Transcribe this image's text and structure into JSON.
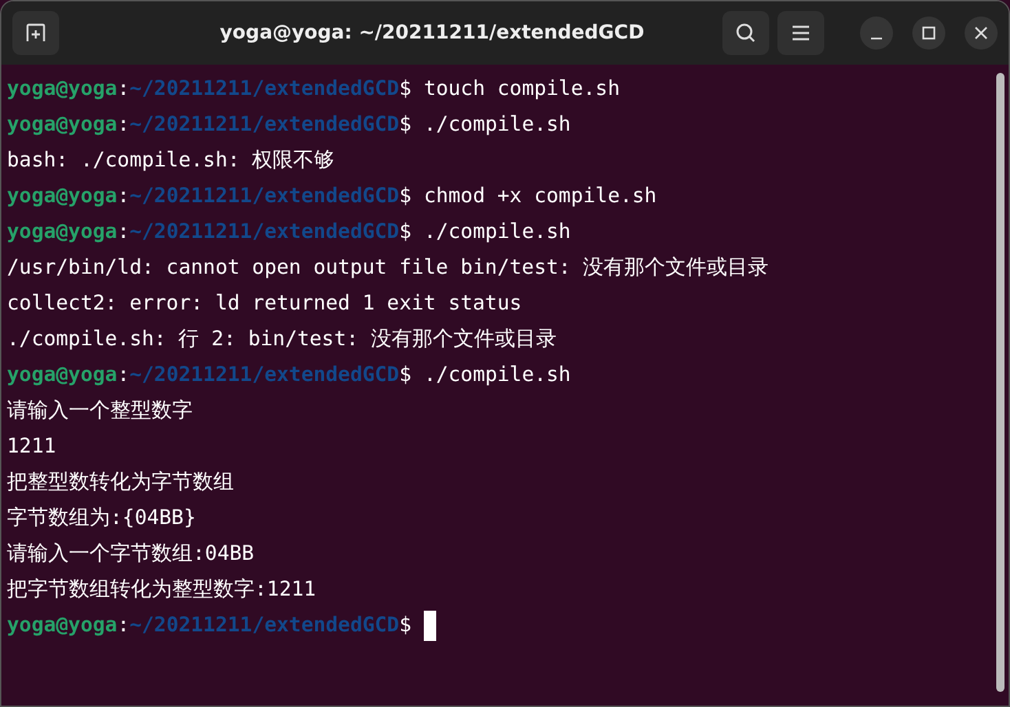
{
  "window": {
    "title": "yoga@yoga: ~/20211211/extendedGCD"
  },
  "lines": [
    {
      "kind": "prompt",
      "user": "yoga@yoga",
      "colon": ":",
      "path": "~/20211211/extendedGCD",
      "dollar": "$",
      "command": " touch compile.sh"
    },
    {
      "kind": "prompt",
      "user": "yoga@yoga",
      "colon": ":",
      "path": "~/20211211/extendedGCD",
      "dollar": "$",
      "command": " ./compile.sh"
    },
    {
      "kind": "output",
      "text": "bash: ./compile.sh: 权限不够"
    },
    {
      "kind": "prompt",
      "user": "yoga@yoga",
      "colon": ":",
      "path": "~/20211211/extendedGCD",
      "dollar": "$",
      "command": " chmod +x compile.sh"
    },
    {
      "kind": "prompt",
      "user": "yoga@yoga",
      "colon": ":",
      "path": "~/20211211/extendedGCD",
      "dollar": "$",
      "command": " ./compile.sh"
    },
    {
      "kind": "output",
      "text": "/usr/bin/ld: cannot open output file bin/test: 没有那个文件或目录"
    },
    {
      "kind": "output",
      "text": "collect2: error: ld returned 1 exit status"
    },
    {
      "kind": "output",
      "text": "./compile.sh: 行 2: bin/test: 没有那个文件或目录"
    },
    {
      "kind": "prompt",
      "user": "yoga@yoga",
      "colon": ":",
      "path": "~/20211211/extendedGCD",
      "dollar": "$",
      "command": " ./compile.sh"
    },
    {
      "kind": "output",
      "text": "请输入一个整型数字"
    },
    {
      "kind": "output",
      "text": "1211"
    },
    {
      "kind": "output",
      "text": "把整型数转化为字节数组"
    },
    {
      "kind": "output",
      "text": "字节数组为:{04BB}"
    },
    {
      "kind": "output",
      "text": "请输入一个字节数组:04BB"
    },
    {
      "kind": "output",
      "text": "把字节数组转化为整型数字:1211"
    },
    {
      "kind": "prompt",
      "user": "yoga@yoga",
      "colon": ":",
      "path": "~/20211211/extendedGCD",
      "dollar": "$",
      "cursor": true
    }
  ]
}
